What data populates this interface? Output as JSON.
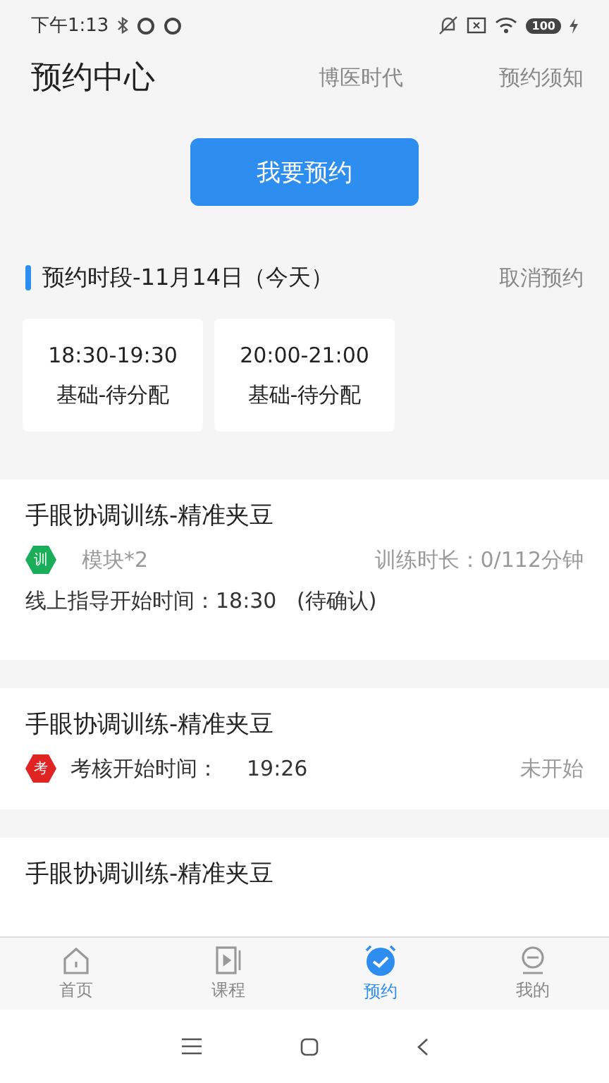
{
  "status_bar": {
    "time": "下午1:13",
    "battery": "100"
  },
  "header": {
    "title": "预约中心",
    "links": [
      "博医时代",
      "预约须知"
    ]
  },
  "book_button": "我要预约",
  "section": {
    "title": "预约时段-11月14日（今天）",
    "action": "取消预约"
  },
  "slots": [
    {
      "time": "18:30-19:30",
      "label": "基础-待分配"
    },
    {
      "time": "20:00-21:00",
      "label": "基础-待分配"
    }
  ],
  "records": [
    {
      "kind": "training",
      "title": "手眼协调训练-精准夹豆",
      "badge": "训",
      "color": "#1aad5a",
      "module": "模块*2",
      "duration": "训练时长：0/112分钟",
      "guidance": "线上指导开始时间：18:30   (待确认)"
    },
    {
      "kind": "exam",
      "title": "手眼协调训练-精准夹豆",
      "badge": "考",
      "color": "#e02424",
      "label": "考核开始时间：",
      "time": "19:26",
      "status": "未开始"
    },
    {
      "kind": "partial",
      "title": "手眼协调训练-精准夹豆"
    }
  ],
  "tabs": [
    {
      "label": "首页",
      "kind": "home",
      "selected": false
    },
    {
      "label": "课程",
      "kind": "course",
      "selected": false
    },
    {
      "label": "预约",
      "kind": "alarm",
      "selected": true
    },
    {
      "label": "我的",
      "kind": "me",
      "selected": false
    }
  ]
}
